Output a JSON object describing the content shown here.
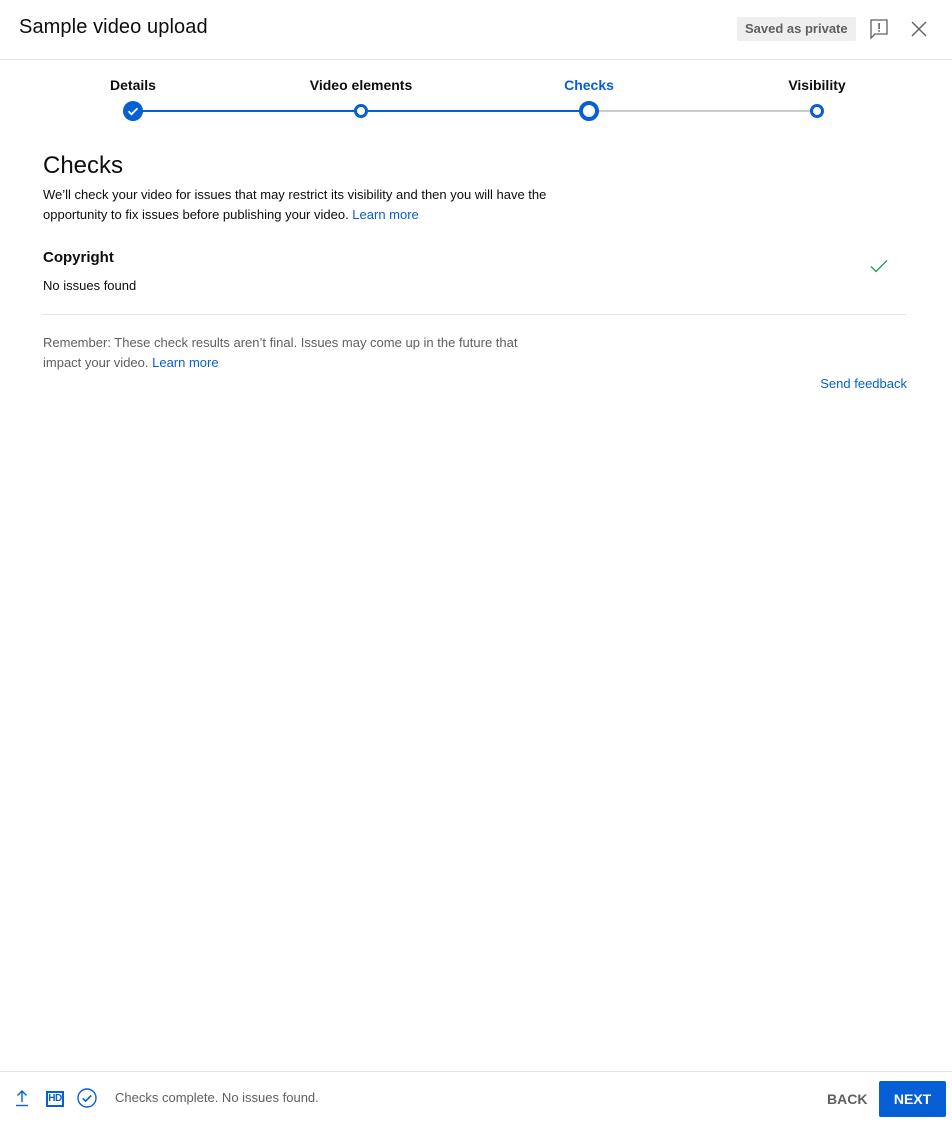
{
  "header": {
    "title": "Sample video upload",
    "saved_badge": "Saved as private",
    "feedback_icon": "report-feedback-icon",
    "close_icon": "close-icon"
  },
  "stepper": {
    "steps": [
      {
        "label": "Details",
        "state": "done"
      },
      {
        "label": "Video elements",
        "state": "done"
      },
      {
        "label": "Checks",
        "state": "active"
      },
      {
        "label": "Visibility",
        "state": "todo"
      }
    ]
  },
  "checks": {
    "heading": "Checks",
    "description": "We’ll check your video for issues that may restrict its visibility and then you will have the opportunity to fix issues before publishing your video. ",
    "learn_more": "Learn more",
    "copyright": {
      "title": "Copyright",
      "status": "No issues found",
      "icon": "check-icon",
      "icon_color": "#0f9d58"
    },
    "remember": "Remember: These check results aren’t final. Issues may come up in the future that impact your video. ",
    "remember_learn_more": "Learn more",
    "send_feedback": "Send feedback"
  },
  "footer": {
    "icons": [
      "upload-icon",
      "hd-icon",
      "check-circle-icon"
    ],
    "hd_label": "HD",
    "status": "Checks complete. No issues found.",
    "back_label": "BACK",
    "next_label": "NEXT"
  },
  "colors": {
    "accent": "#065fd4",
    "text_secondary": "#606060",
    "success": "#0f9d58"
  }
}
